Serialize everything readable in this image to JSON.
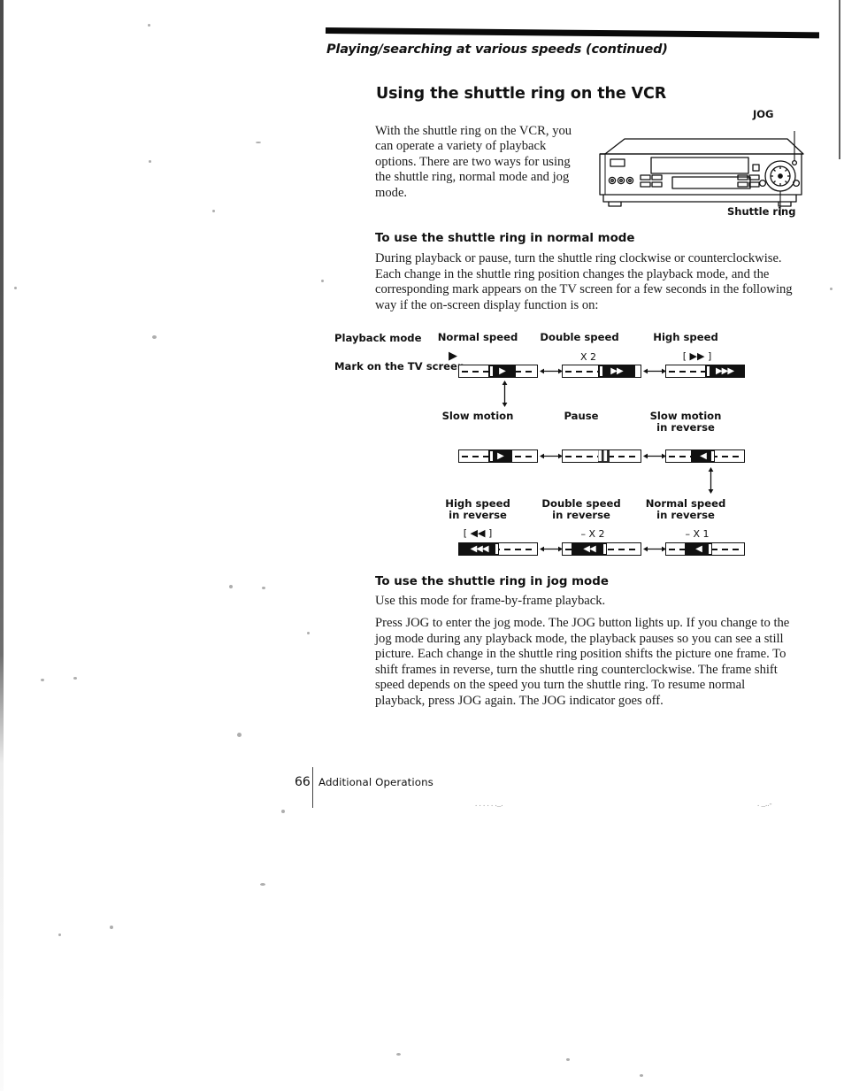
{
  "page": {
    "running_head": "Playing/searching at various speeds",
    "running_head_suffix": "(continued)",
    "number": "66",
    "footer_section": "Additional Operations"
  },
  "heading": "Using the shuttle ring on the VCR",
  "intro": "With the shuttle ring on the VCR, you can operate a variety of playback options.  There are two ways for using the shuttle ring, normal mode and jog mode.",
  "illustration": {
    "jog_label": "JOG",
    "shuttle_label": "Shuttle ring"
  },
  "normal_mode": {
    "heading": "To use the shuttle ring in normal mode",
    "body": "During playback or pause, turn the shuttle ring clockwise or counterclockwise.  Each change in the shuttle ring position changes the playback mode, and the corresponding mark appears on the TV screen for a few seconds in the following way if the on-screen display function is on:"
  },
  "diagram": {
    "row_label_mode": "Playback mode",
    "row_label_mark": "Mark on the TV screen",
    "row1": [
      {
        "title": "Normal speed",
        "caption": "▶"
      },
      {
        "title": "Double speed",
        "caption": "X 2"
      },
      {
        "title": "High speed",
        "caption": "[ ▶▶ ]"
      }
    ],
    "row2": [
      {
        "title": "Slow motion",
        "caption": ""
      },
      {
        "title": "Pause",
        "caption": ""
      },
      {
        "title": "Slow motion\nin reverse",
        "caption": ""
      }
    ],
    "row3": [
      {
        "title": "High speed\nin reverse",
        "caption": "[ ◀◀ ]"
      },
      {
        "title": "Double speed\nin reverse",
        "caption": "– X 2"
      },
      {
        "title": "Normal speed\nin reverse",
        "caption": "– X 1"
      }
    ]
  },
  "jog_mode": {
    "heading": "To use the shuttle ring in jog mode",
    "body1": "Use this mode for frame-by-frame playback.",
    "body2": "Press JOG to enter the jog mode.  The JOG button lights up.  If you change to the jog mode during any playback mode, the playback pauses so you can see a still picture.  Each change in the shuttle ring position shifts the picture one frame.  To shift frames in reverse, turn the shuttle ring counterclockwise. The frame shift speed depends on the speed you turn the shuttle ring. To resume normal playback, press JOG again.  The JOG indicator goes off."
  }
}
